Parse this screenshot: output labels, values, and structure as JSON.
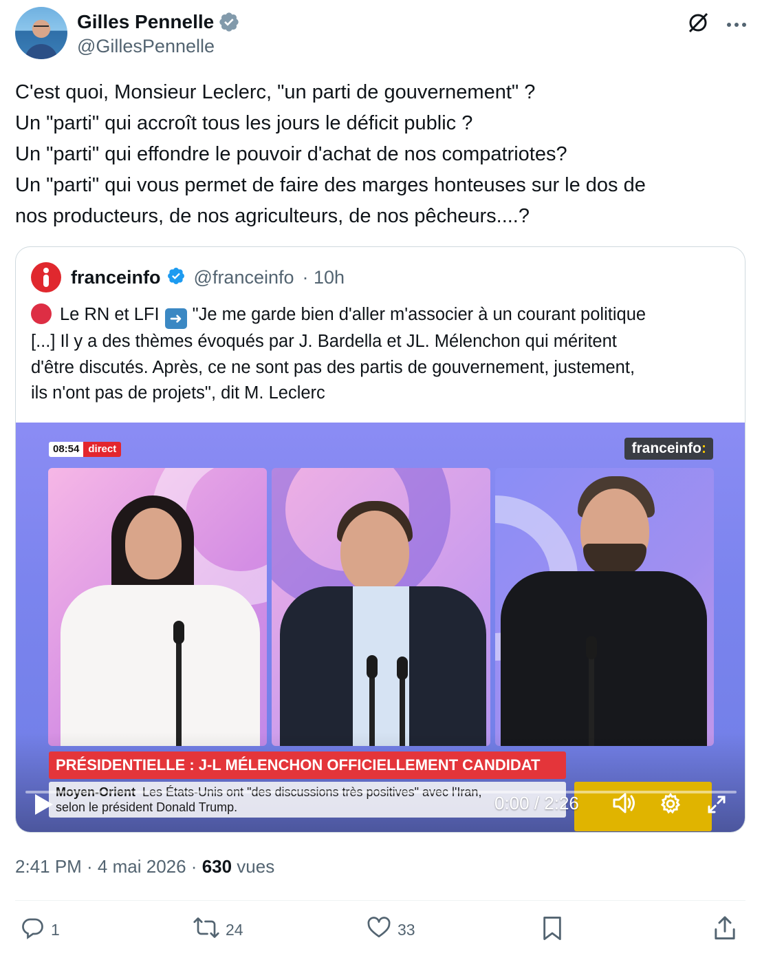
{
  "author": {
    "display_name": "Gilles Pennelle",
    "handle": "@GillesPennelle"
  },
  "tweet_lines": [
    "C'est quoi, Monsieur Leclerc, \"un parti de gouvernement\" ?",
    "Un \"parti\" qui accroît tous les jours le déficit public ?",
    "Un \"parti\" qui effondre le pouvoir d'achat de nos compatriotes?",
    "Un \"parti\" qui vous permet de faire des marges honteuses sur le dos de",
    "nos producteurs, de nos agriculteurs, de nos pêcheurs....?"
  ],
  "quote": {
    "name": "franceinfo",
    "handle": "@franceinfo",
    "time": "· 10h",
    "line1_a": "Le RN et LFI",
    "line1_b": "\"Je me garde bien d'aller m'associer à un courant politique",
    "line2": "[...] Il y a des thèmes évoqués par J. Bardella et JL. Mélenchon qui méritent",
    "line3": "d'être discutés. Après, ce ne sont pas des partis de gouvernement, justement,",
    "line4": "ils n'ont pas de projets\", dit M. Leclerc",
    "video": {
      "clock": "08:54",
      "live_label": "direct",
      "channel_logo": "franceinfo",
      "channel_logo_suffix": ":",
      "headline": "PRÉSIDENTIELLE : J-L MÉLENCHON OFFICIELLEMENT CANDIDAT",
      "ticker_topic": "Moyen-Orient",
      "ticker_line1": "Les États-Unis ont \"des discussions très positives\" avec l'Iran,",
      "ticker_line2": "selon le président Donald Trump.",
      "playback_time": "0:00 / 2:26",
      "progress": 0
    }
  },
  "meta": {
    "time": "2:41 PM · 4 mai 2026 · ",
    "views_count": "630",
    "views_label": " vues"
  },
  "actions": {
    "replies": "1",
    "reposts": "24",
    "likes": "33"
  },
  "colors": {
    "accent_blue": "#1d9bf0",
    "franceinfo_red": "#e0282e",
    "text_secondary": "#536471"
  }
}
